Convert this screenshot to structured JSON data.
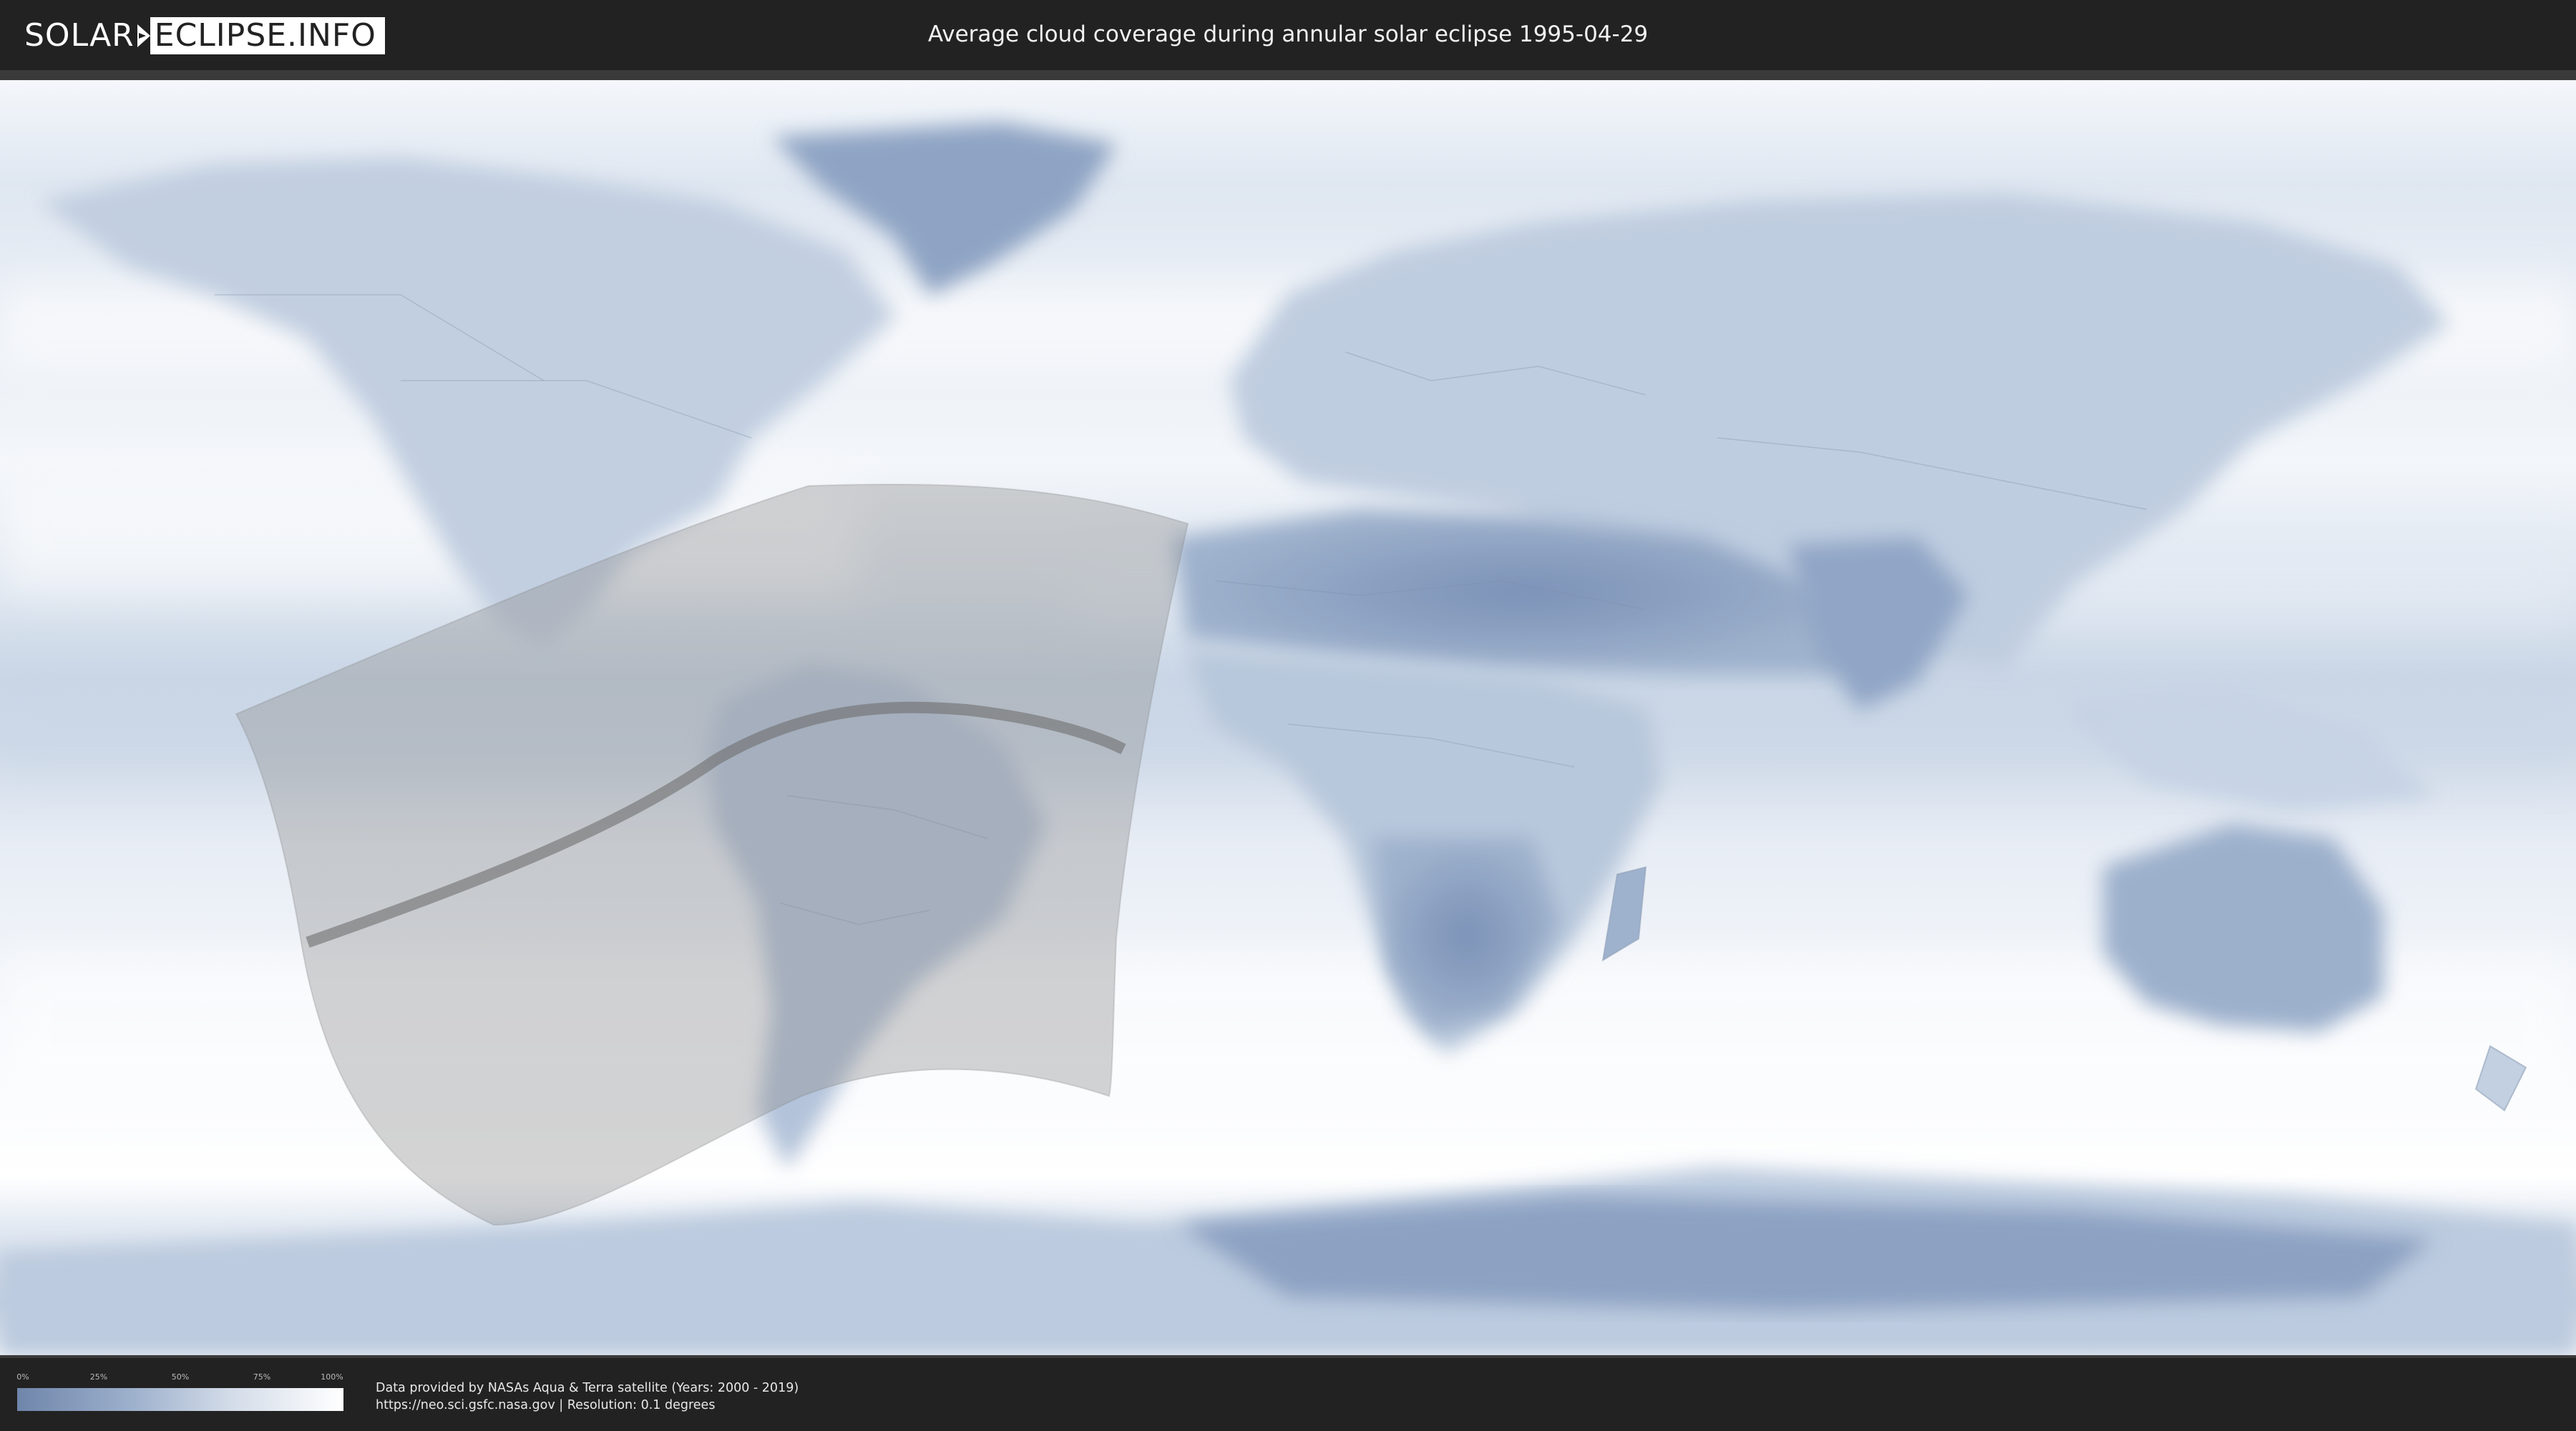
{
  "header": {
    "logo_left": "SOLAR",
    "logo_right": "ECLIPSE.INFO",
    "title": "Average cloud coverage during annular solar eclipse 1995-04-29"
  },
  "map": {
    "type": "world cloud coverage map (equirectangular)",
    "base_color_clear": "#6f86ab",
    "base_color_cloudy": "#ffffff",
    "overlay_color": "#9a9a9a",
    "path_color": "#7a7a7a"
  },
  "legend": {
    "ticks": [
      "0%",
      "25%",
      "50%",
      "75%",
      "100%"
    ],
    "gradient_from": "#6f86ab",
    "gradient_to": "#ffffff"
  },
  "credits": {
    "line1": "Data provided by NASAs Aqua & Terra satellite (Years: 2000 - 2019)",
    "line2": "https://neo.sci.gsfc.nasa.gov | Resolution: 0.1 degrees"
  }
}
